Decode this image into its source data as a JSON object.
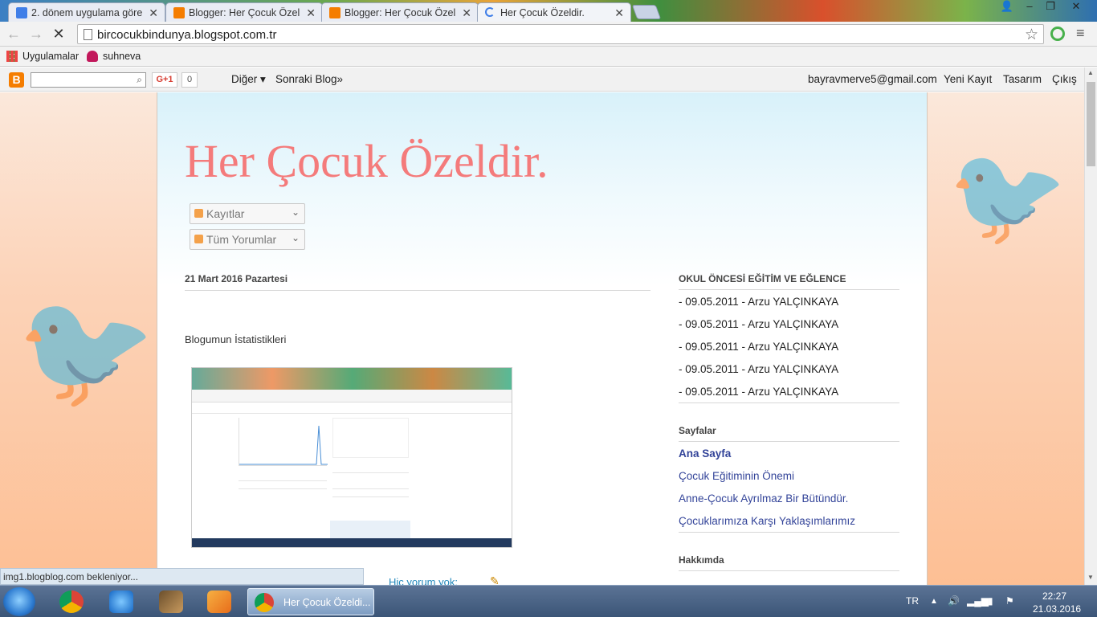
{
  "browser": {
    "tabs": [
      {
        "title": "2. dönem uygulama göre",
        "icon": "docs-icon"
      },
      {
        "title": "Blogger: Her Çocuk Özel",
        "icon": "blogger-icon"
      },
      {
        "title": "Blogger: Her Çocuk Özel",
        "icon": "blogger-icon"
      },
      {
        "title": "Her Çocuk Özeldir.",
        "icon": "loading-icon"
      }
    ],
    "url": "bircocukbindunya.blogspot.com.tr",
    "bookmarks": [
      {
        "label": "Uygulamalar",
        "icon": "apps-icon"
      },
      {
        "label": "suhneva",
        "icon": "flower-icon"
      }
    ]
  },
  "navbar": {
    "gplus_label": "G+1",
    "gplus_count": "0",
    "more_label": "Diğer ▾",
    "next_blog_label": "Sonraki Blog»",
    "email": "bayravmerve5@gmail.com",
    "new_post": "Yeni Kayıt",
    "design": "Tasarım",
    "logout": "Çıkış"
  },
  "blog": {
    "title": "Her Çocuk Özeldir.",
    "feeds": [
      "Kayıtlar",
      "Tüm Yorumlar"
    ],
    "post": {
      "date": "21 Mart 2016 Pazartesi",
      "title": "Blogumun İstatistikleri",
      "comments": "Hiç yorum yok:"
    },
    "sidebar": {
      "section1_title": "OKUL ÖNCESİ EĞİTİM VE EĞLENCE",
      "section1_items": [
        "- 09.05.2011 - Arzu YALÇINKAYA",
        "- 09.05.2011 - Arzu YALÇINKAYA",
        "- 09.05.2011 - Arzu YALÇINKAYA",
        "- 09.05.2011 - Arzu YALÇINKAYA",
        "- 09.05.2011 - Arzu YALÇINKAYA"
      ],
      "pages_title": "Sayfalar",
      "pages": [
        "Ana Sayfa",
        "Çocuk Eğitiminin Önemi",
        "Anne-Çocuk Ayrılmaz Bir Bütündür.",
        "Çocuklarımıza Karşı Yaklaşımlarımız"
      ],
      "about_title": "Hakkımda"
    }
  },
  "status_text": "img1.blogblog.com bekleniyor...",
  "taskbar": {
    "active_window": "Her Çocuk Özeldi...",
    "language": "TR",
    "time": "22:27",
    "date": "21.03.2016"
  },
  "colors": {
    "title_pink": "#f47b7b",
    "page_link": "#334499",
    "comment_link": "#2288bb",
    "blogger_orange": "#f57d00"
  }
}
